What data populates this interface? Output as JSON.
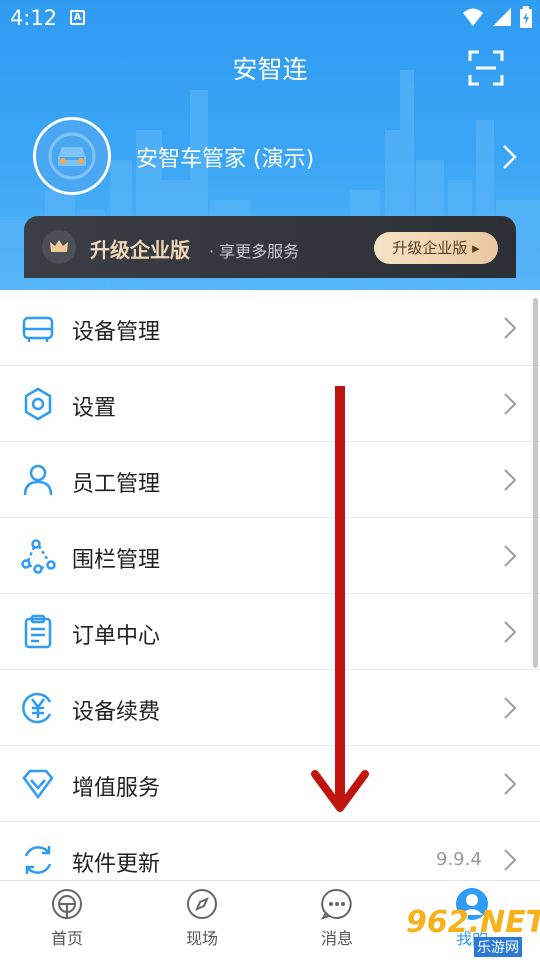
{
  "status": {
    "time": "4:12",
    "app_badge": "A"
  },
  "header": {
    "title": "安智连",
    "profile_name": "安智车管家 (演示)"
  },
  "upgrade": {
    "title": "升级企业版",
    "subtitle": "· 享更多服务",
    "button": "升级企业版 ▸"
  },
  "menu": [
    {
      "label": "设备管理",
      "icon": "device-icon"
    },
    {
      "label": "设置",
      "icon": "gear-icon"
    },
    {
      "label": "员工管理",
      "icon": "person-icon"
    },
    {
      "label": "围栏管理",
      "icon": "fence-icon"
    },
    {
      "label": "订单中心",
      "icon": "clipboard-icon"
    },
    {
      "label": "设备续费",
      "icon": "yuan-icon"
    },
    {
      "label": "增值服务",
      "icon": "diamond-icon"
    },
    {
      "label": "软件更新",
      "icon": "refresh-icon",
      "value": "9.9.4"
    }
  ],
  "tabs": [
    {
      "label": "首页",
      "icon": "home-icon"
    },
    {
      "label": "现场",
      "icon": "compass-icon"
    },
    {
      "label": "消息",
      "icon": "message-icon"
    },
    {
      "label": "我的",
      "icon": "profile-icon"
    }
  ],
  "watermark": {
    "main": "962.NET",
    "sub": "乐游网"
  },
  "colors": {
    "accent": "#2f9bf2",
    "upgrade_bg": "#2c2f35",
    "gold": "#f0d7b7",
    "arrow": "#c0140f"
  }
}
